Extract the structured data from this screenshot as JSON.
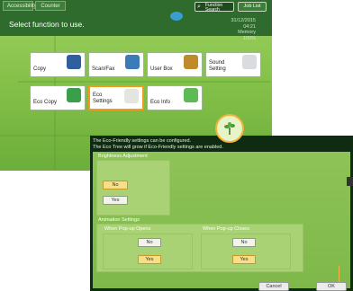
{
  "top_bar": {
    "tabs": [
      "Accessibility",
      "Counter"
    ],
    "search_label": "Function Search",
    "job_list_label": "Job List"
  },
  "header": {
    "title": "Select function to use.",
    "date": "31/12/2015",
    "time": "04:21",
    "memory_label": "Memory",
    "memory_value": "100%"
  },
  "tiles": [
    {
      "label": "Copy"
    },
    {
      "label": "Scan/Fax"
    },
    {
      "label": "User Box"
    },
    {
      "label": "Sound Setting"
    },
    {
      "label": "Eco Copy"
    },
    {
      "label": "Eco Settings"
    },
    {
      "label": "Eco Info"
    }
  ],
  "eco_dialog": {
    "message_line1": "The Eco-Friendly settings can be configured.",
    "message_line2": "The Eco Tree will grow if Eco-Friendly settings are enabled.",
    "brightness": {
      "title": "Brightness Adjustment",
      "no": "No",
      "yes": "Yes",
      "selected": "No"
    },
    "animation": {
      "title": "Animation Settings",
      "popup_opens": {
        "title": "When Pop-up Opens",
        "no": "No",
        "yes": "Yes",
        "selected": "Yes"
      },
      "popup_closes": {
        "title": "When Pop-up Closes",
        "no": "No",
        "yes": "Yes",
        "selected": "Yes"
      }
    },
    "cancel_label": "Cancel",
    "ok_label": "OK"
  },
  "colors": {
    "accent": "#f09a1f",
    "background_green": "#86c24a",
    "dark_green": "#2f6b2d"
  }
}
